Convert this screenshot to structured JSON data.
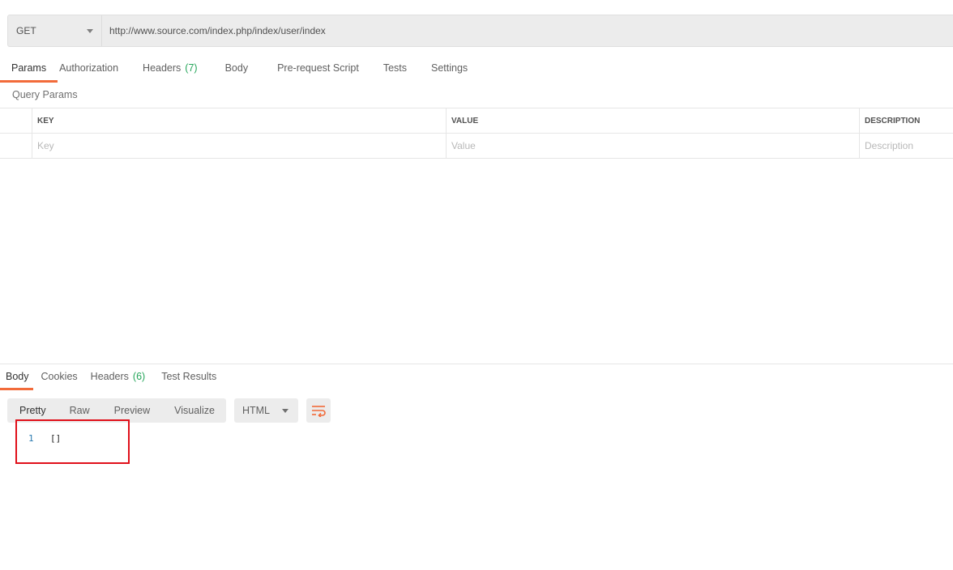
{
  "request": {
    "method": "GET",
    "url": "http://www.source.com/index.php/index/user/index"
  },
  "request_tabs": [
    {
      "label": "Params",
      "count": "",
      "active": true
    },
    {
      "label": "Authorization",
      "count": ""
    },
    {
      "label": "Headers",
      "count": "(7)"
    },
    {
      "label": "Body",
      "count": ""
    },
    {
      "label": "Pre-request Script",
      "count": ""
    },
    {
      "label": "Tests",
      "count": ""
    },
    {
      "label": "Settings",
      "count": ""
    }
  ],
  "query_params": {
    "title": "Query Params",
    "columns": [
      "KEY",
      "VALUE",
      "DESCRIPTION"
    ],
    "placeholders": {
      "key": "Key",
      "value": "Value",
      "description": "Description"
    }
  },
  "response_tabs": [
    {
      "label": "Body",
      "count": "",
      "active": true
    },
    {
      "label": "Cookies",
      "count": ""
    },
    {
      "label": "Headers",
      "count": "(6)"
    },
    {
      "label": "Test Results",
      "count": ""
    }
  ],
  "response_view": {
    "modes": [
      "Pretty",
      "Raw",
      "Preview",
      "Visualize"
    ],
    "active_mode": "Pretty",
    "language": "HTML",
    "wrap_icon": "wrap-lines-icon"
  },
  "response_body": {
    "line_number": "1",
    "content": "[]"
  },
  "colors": {
    "accent": "#f26b3a",
    "count": "#26a65b",
    "highlight_box": "#e0101a"
  }
}
